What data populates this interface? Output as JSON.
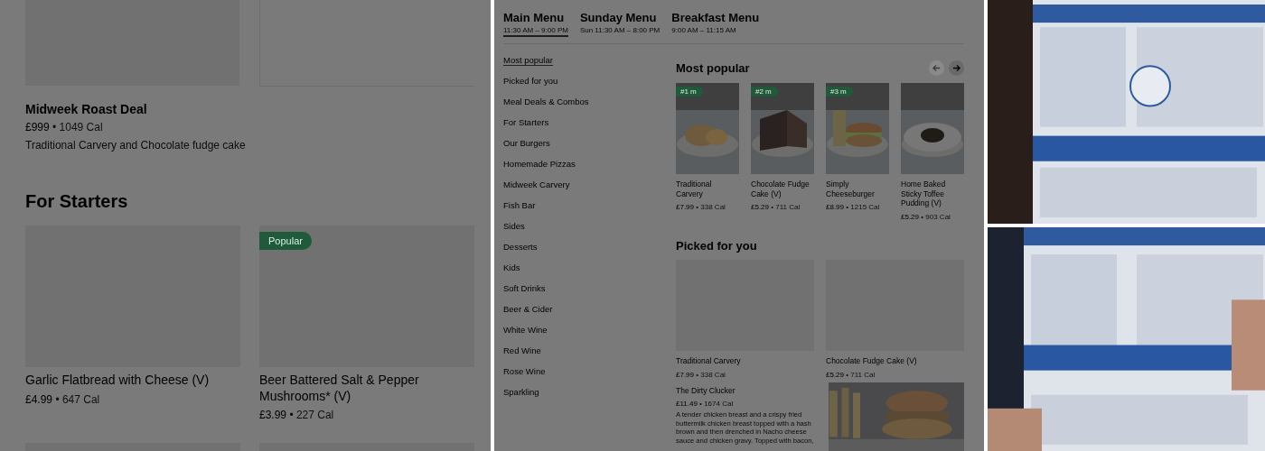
{
  "left_screen": {
    "featured": {
      "title": "Midweek Roast Deal",
      "price": "£999",
      "calories": "• 1049 Cal",
      "description": "Traditional Carvery and Chocolate fudge cake"
    },
    "section": {
      "title": "For Starters",
      "items": [
        {
          "title": "Garlic Flatbread with Cheese (V)",
          "price": "£4.99",
          "calories": "• 647 Cal"
        },
        {
          "title": "Beer Battered Salt & Pepper Mushrooms* (V)",
          "price": "£3.99",
          "calories": "• 227 Cal",
          "badge": "Popular"
        }
      ]
    }
  },
  "right_screen": {
    "tabs": [
      {
        "label": "Main Menu",
        "hours": "11:30 AM – 9:00 PM",
        "selected": true
      },
      {
        "label": "Sunday Menu",
        "hours": "Sun 11:30 AM – 8:00 PM",
        "selected": false
      },
      {
        "label": "Breakfast Menu",
        "hours": "9:00 AM – 11:15 AM",
        "selected": false
      }
    ],
    "categories": [
      {
        "label": "Most popular",
        "selected": true
      },
      {
        "label": "Picked for you",
        "selected": false
      },
      {
        "label": "Meal Deals & Combos",
        "selected": false
      },
      {
        "label": "For Starters",
        "selected": false
      },
      {
        "label": "Our Burgers",
        "selected": false
      },
      {
        "label": "Homemade Pizzas",
        "selected": false
      },
      {
        "label": "Midweek Carvery",
        "selected": false
      },
      {
        "label": "Fish Bar",
        "selected": false
      },
      {
        "label": "Sides",
        "selected": false
      },
      {
        "label": "Desserts",
        "selected": false
      },
      {
        "label": "Kids",
        "selected": false
      },
      {
        "label": "Soft Drinks",
        "selected": false
      },
      {
        "label": "Beer & Cider",
        "selected": false
      },
      {
        "label": "White Wine",
        "selected": false
      },
      {
        "label": "Red Wine",
        "selected": false
      },
      {
        "label": "Rose Wine",
        "selected": false
      },
      {
        "label": "Sparkling",
        "selected": false
      }
    ],
    "most_popular": {
      "title": "Most popular",
      "items": [
        {
          "badge": "#1 m",
          "title": "Traditional Carvery",
          "price": "£7.99",
          "calories": "• 338 Cal"
        },
        {
          "badge": "#2 m",
          "title": "Chocolate Fudge Cake (V)",
          "price": "£5.29",
          "calories": "• 711 Cal"
        },
        {
          "badge": "#3 m",
          "title": "Simply Cheeseburger",
          "price": "£8.99",
          "calories": "• 1215 Cal"
        },
        {
          "title": "Home Baked Sticky Toffee Pudding (V)",
          "price": "£5.29",
          "calories": "• 903 Cal"
        }
      ]
    },
    "picked": {
      "title": "Picked for you",
      "items": [
        {
          "title": "Traditional Carvery",
          "price": "£7.99",
          "calories": "• 338 Cal"
        },
        {
          "title": "Chocolate Fudge Cake (V)",
          "price": "£5.29",
          "calories": "• 711 Cal"
        }
      ],
      "detail": {
        "title": "The Dirty Clucker",
        "price": "£11.49",
        "calories": "• 1674 Cal",
        "description": "A tender chicken breast and a crispy fried buttermilk chicken breast topped with a hash brown and then drenched in Nacho cheese sauce and chicken gravy. Topped with bacon,"
      }
    }
  }
}
